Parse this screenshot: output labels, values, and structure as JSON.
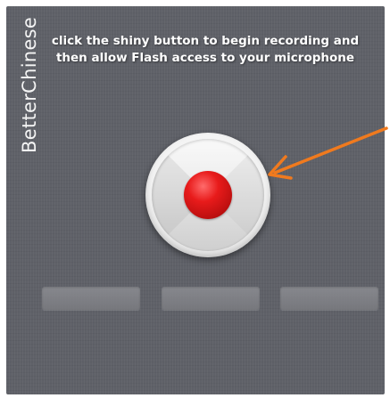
{
  "brand": {
    "name": "BetterChinese"
  },
  "instructions": {
    "line1": "click the shiny button to begin recording and",
    "line2": "then allow Flash access to your microphone"
  },
  "record_button": {
    "icon": "record-dot-icon",
    "dot_color": "#d81818",
    "state": "idle"
  },
  "pointer_arrow": {
    "icon": "arrow-pointer-icon",
    "color": "#f07a1e"
  },
  "recording_slots": [
    {
      "label": ""
    },
    {
      "label": ""
    },
    {
      "label": ""
    }
  ],
  "colors": {
    "panel_background": "#5f6168",
    "text": "#ffffff"
  }
}
